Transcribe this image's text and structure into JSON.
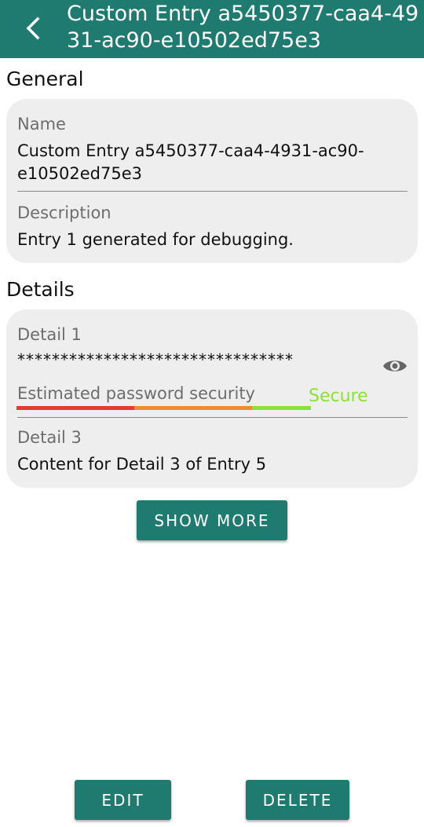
{
  "app_bar": {
    "title": "Custom Entry a5450377-caa4-4931-ac90-e10502ed75e3",
    "background_color": "#1f7a70",
    "back_icon": "chevron-left-icon"
  },
  "general": {
    "heading": "General",
    "name_label": "Name",
    "name_value": "Custom Entry a5450377-caa4-4931-ac90-e10502ed75e3",
    "description_label": "Description",
    "description_value": "Entry 1 generated for debugging."
  },
  "details": {
    "heading": "Details",
    "detail1_label": "Detail 1",
    "detail1_value": "********************************",
    "visibility_icon": "eye-icon",
    "password_strength_label": "Estimated password security",
    "password_strength_value": "Secure",
    "strength_colors": [
      "#e53935",
      "#ef8c2f",
      "#8ae234"
    ],
    "detail3_label": "Detail 3",
    "detail3_value": "Content for Detail 3 of Entry 5"
  },
  "buttons": {
    "show_more": "SHOW MORE",
    "edit": "EDIT",
    "delete": "DELETE"
  }
}
